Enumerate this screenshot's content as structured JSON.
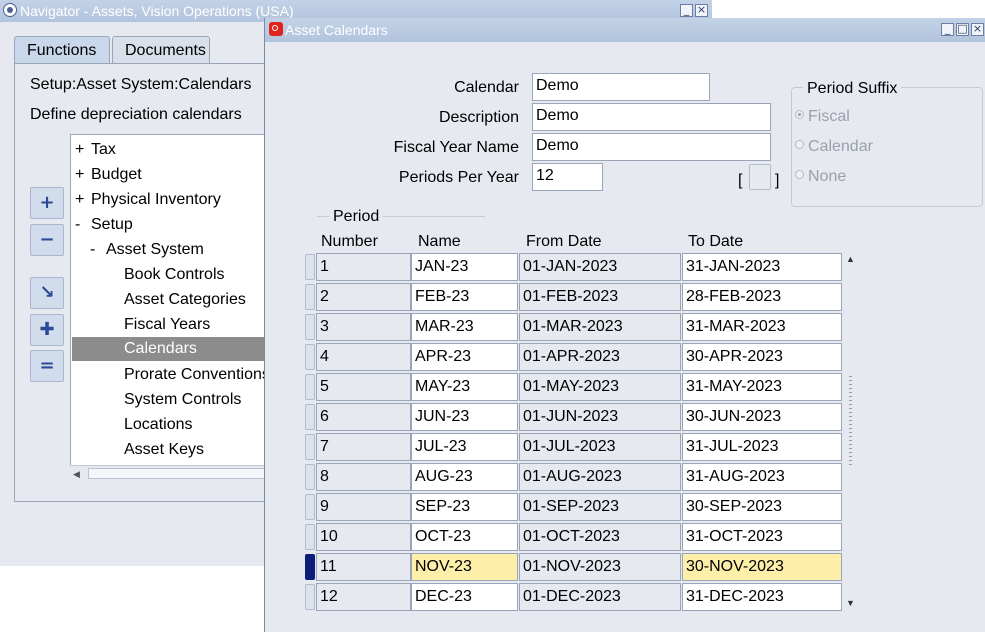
{
  "navigator": {
    "title": "Navigator - Assets, Vision Operations (USA)",
    "tabs": [
      "Functions",
      "Documents"
    ],
    "path": "Setup:Asset System:Calendars",
    "description": "Define depreciation calendars",
    "tree": [
      {
        "sign": "+",
        "label": "Tax"
      },
      {
        "sign": "+",
        "label": "Budget"
      },
      {
        "sign": "+",
        "label": "Physical Inventory"
      },
      {
        "sign": "-",
        "label": "Setup"
      },
      {
        "sign": "-",
        "label": "Asset System"
      },
      {
        "sign": "",
        "label": "Book Controls"
      },
      {
        "sign": "",
        "label": "Asset Categories"
      },
      {
        "sign": "",
        "label": "Fiscal Years"
      },
      {
        "sign": "",
        "label": "Calendars",
        "selected": true
      },
      {
        "sign": "",
        "label": "Prorate Conventions"
      },
      {
        "sign": "",
        "label": "System Controls"
      },
      {
        "sign": "",
        "label": "Locations"
      },
      {
        "sign": "",
        "label": "Asset Keys"
      }
    ],
    "buttons": [
      "expand-icon",
      "collapse-icon",
      "expand-branch-icon",
      "expand-all-icon",
      "collapse-all-icon"
    ]
  },
  "calendar_form": {
    "title": "Asset Calendars",
    "labels": {
      "calendar": "Calendar",
      "description": "Description",
      "fiscal_year_name": "Fiscal Year Name",
      "periods_per_year": "Periods Per Year"
    },
    "values": {
      "calendar": "Demo",
      "description": "Demo",
      "fiscal_year_name": "Demo",
      "periods_per_year": "12"
    },
    "bracket_left": "[",
    "bracket_right": "]",
    "period_suffix": {
      "title": "Period Suffix",
      "options": [
        "Fiscal",
        "Calendar",
        "None"
      ],
      "selected": "Fiscal"
    },
    "period_group": "Period",
    "columns": [
      "Number",
      "Name",
      "From Date",
      "To Date"
    ],
    "rows": [
      [
        "1",
        "JAN-23",
        "01-JAN-2023",
        "31-JAN-2023"
      ],
      [
        "2",
        "FEB-23",
        "01-FEB-2023",
        "28-FEB-2023"
      ],
      [
        "3",
        "MAR-23",
        "01-MAR-2023",
        "31-MAR-2023"
      ],
      [
        "4",
        "APR-23",
        "01-APR-2023",
        "30-APR-2023"
      ],
      [
        "5",
        "MAY-23",
        "01-MAY-2023",
        "31-MAY-2023"
      ],
      [
        "6",
        "JUN-23",
        "01-JUN-2023",
        "30-JUN-2023"
      ],
      [
        "7",
        "JUL-23",
        "01-JUL-2023",
        "31-JUL-2023"
      ],
      [
        "8",
        "AUG-23",
        "01-AUG-2023",
        "31-AUG-2023"
      ],
      [
        "9",
        "SEP-23",
        "01-SEP-2023",
        "30-SEP-2023"
      ],
      [
        "10",
        "OCT-23",
        "01-OCT-2023",
        "31-OCT-2023"
      ],
      [
        "11",
        "NOV-23",
        "01-NOV-2023",
        "30-NOV-2023"
      ],
      [
        "12",
        "DEC-23",
        "01-DEC-2023",
        "31-DEC-2023"
      ]
    ],
    "current_row": 11
  },
  "colors": {
    "titlebar": "#b2c4dd",
    "window_bg": "#e6eaf0",
    "selected_tree": "#8c8c8c",
    "current_row_highlight": "#fdeeaa",
    "row_indicator": "#0b1f7a"
  }
}
